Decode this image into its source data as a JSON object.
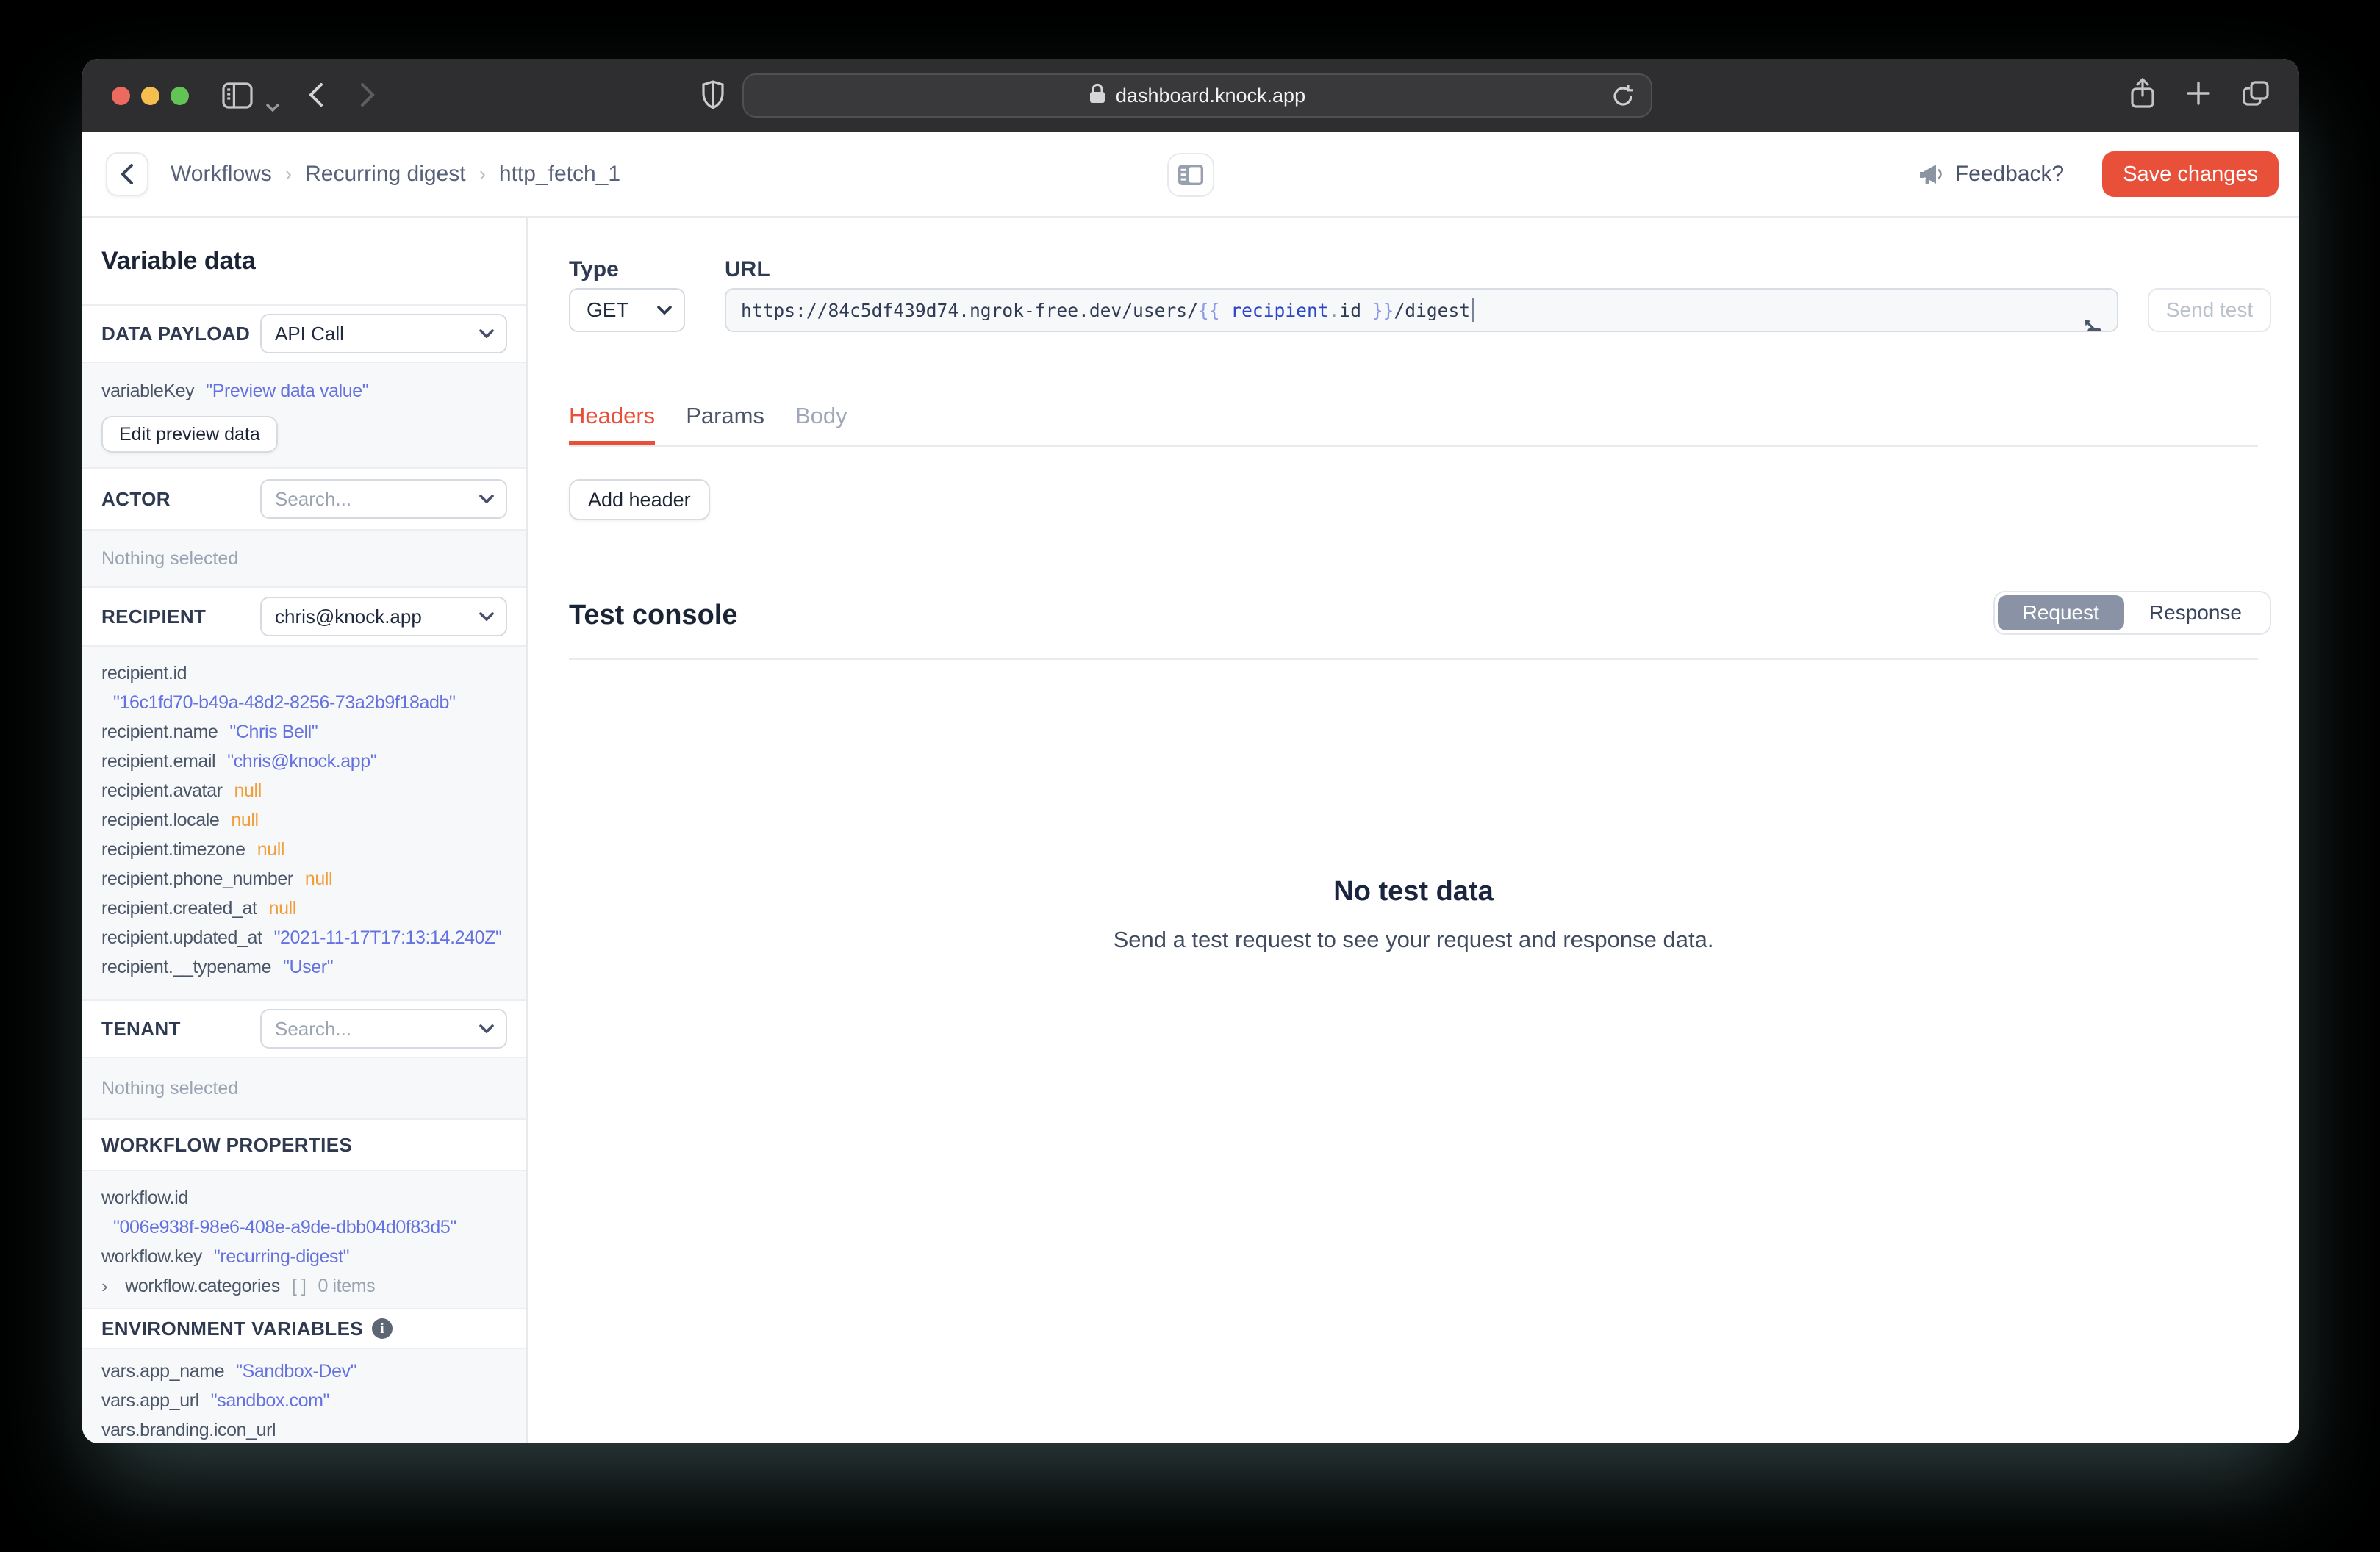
{
  "browser": {
    "url": "dashboard.knock.app",
    "traffic_lights": {
      "close": "#ed6a5e",
      "minimize": "#f5bf4f",
      "maximize": "#61c454"
    }
  },
  "app_header": {
    "breadcrumb": {
      "items": [
        "Workflows",
        "Recurring digest",
        "http_fetch_1"
      ],
      "separator": "›"
    },
    "feedback_label": "Feedback?",
    "save_button": "Save changes"
  },
  "sidebar": {
    "title": "Variable data",
    "data_payload": {
      "label": "DATA PAYLOAD",
      "value": "API Call"
    },
    "preview": {
      "key": "variableKey",
      "value": "\"Preview data value\"",
      "edit_button": "Edit preview data"
    },
    "actor": {
      "label": "ACTOR",
      "placeholder": "Search...",
      "empty": "Nothing selected"
    },
    "recipient": {
      "label": "RECIPIENT",
      "value": "chris@knock.app",
      "fields": [
        {
          "key": "recipient.id",
          "value": "\"16c1fd70-b49a-48d2-8256-73a2b9f18adb\""
        },
        {
          "key": "recipient.name",
          "value": "\"Chris Bell\""
        },
        {
          "key": "recipient.email",
          "value": "\"chris@knock.app\""
        },
        {
          "key": "recipient.avatar",
          "value": "null"
        },
        {
          "key": "recipient.locale",
          "value": "null"
        },
        {
          "key": "recipient.timezone",
          "value": "null"
        },
        {
          "key": "recipient.phone_number",
          "value": "null"
        },
        {
          "key": "recipient.created_at",
          "value": "null"
        },
        {
          "key": "recipient.updated_at",
          "value": "\"2021-11-17T17:13:14.240Z\""
        },
        {
          "key": "recipient.__typename",
          "value": "\"User\""
        }
      ]
    },
    "tenant": {
      "label": "TENANT",
      "placeholder": "Search...",
      "empty": "Nothing selected"
    },
    "workflow": {
      "label": "WORKFLOW PROPERTIES",
      "fields": [
        {
          "key": "workflow.id",
          "value": "\"006e938f-98e6-408e-a9de-dbb04d0f83d5\""
        },
        {
          "key": "workflow.key",
          "value": "\"recurring-digest\""
        },
        {
          "key": "workflow.categories",
          "bracket": "[ ]",
          "count": "0 items"
        }
      ]
    },
    "env": {
      "label": "ENVIRONMENT VARIABLES",
      "fields": [
        {
          "key": "vars.app_name",
          "value": "\"Sandbox-Dev\""
        },
        {
          "key": "vars.app_url",
          "value": "\"sandbox.com\""
        },
        {
          "key": "vars.branding.icon_url",
          "value": ""
        }
      ]
    }
  },
  "request": {
    "type_label": "Type",
    "method": "GET",
    "url_label": "URL",
    "url": {
      "base": "https://84c5df439d74.ngrok-free.dev/users/",
      "open": "{{",
      "var": " recipient",
      "dot": ".",
      "prop": "id",
      "close": " }}",
      "tail": "/digest"
    },
    "send_test": "Send test",
    "tabs": {
      "headers": "Headers",
      "params": "Params",
      "body": "Body"
    },
    "add_header": "Add header"
  },
  "console": {
    "title": "Test console",
    "toggle": {
      "request": "Request",
      "response": "Response"
    },
    "empty_title": "No test data",
    "empty_subtitle": "Send a test request to see your request and response data."
  },
  "colors": {
    "accent": "#e8503a",
    "string_value": "#6472e0",
    "null_value": "#f29d38"
  }
}
